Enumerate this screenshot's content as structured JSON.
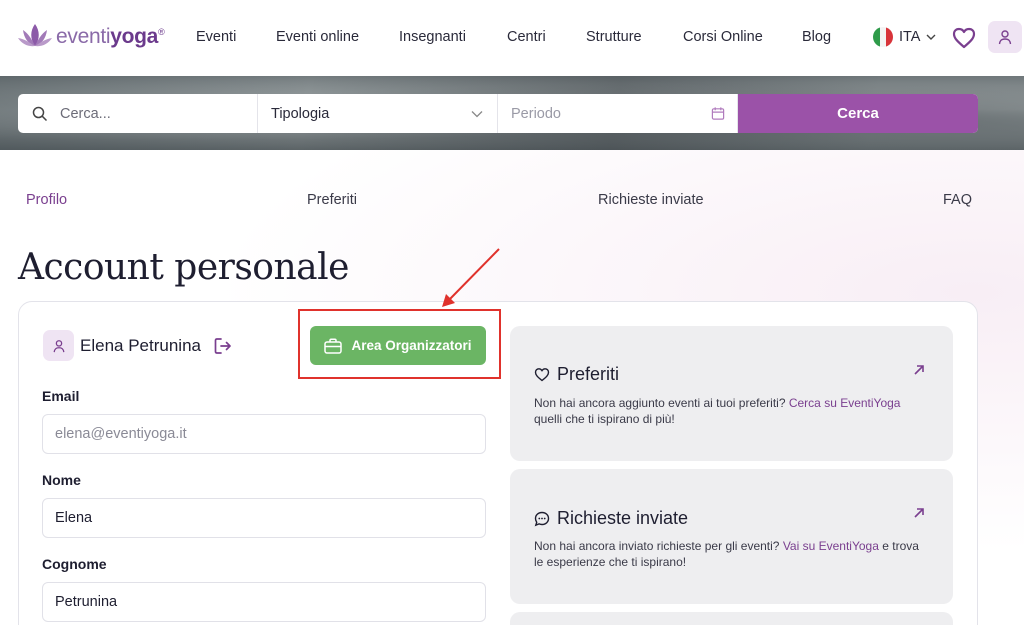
{
  "brand": {
    "logo_part1": "eventi",
    "logo_part2": "yoga",
    "logo_mark": "®",
    "accent": "#9b52a8",
    "green": "#6bb564"
  },
  "nav": {
    "items": [
      {
        "label": "Eventi"
      },
      {
        "label": "Eventi online"
      },
      {
        "label": "Insegnanti"
      },
      {
        "label": "Centri"
      },
      {
        "label": "Strutture"
      },
      {
        "label": "Corsi Online"
      },
      {
        "label": "Blog"
      }
    ],
    "language": "ITA",
    "icons": [
      "italy-flag-icon",
      "chevron-down-icon",
      "heart-icon",
      "user-icon"
    ]
  },
  "search": {
    "query_placeholder": "Cerca...",
    "type_label": "Tipologia",
    "period_placeholder": "Periodo",
    "button_label": "Cerca"
  },
  "tabs": [
    {
      "label": "Profilo",
      "active": true
    },
    {
      "label": "Preferiti",
      "active": false
    },
    {
      "label": "Richieste inviate",
      "active": false
    },
    {
      "label": "FAQ",
      "active": false
    }
  ],
  "page": {
    "title": "Account personale"
  },
  "profile": {
    "name": "Elena Petrunina",
    "organizer_button": "Area Organizzatori",
    "fields": {
      "email_label": "Email",
      "email_value": "elena@eventiyoga.it",
      "name_label": "Nome",
      "name_value": "Elena",
      "surname_label": "Cognome",
      "surname_value": "Petrunina"
    }
  },
  "panels": {
    "favorites": {
      "title": "Preferiti",
      "text": "Non hai ancora aggiunto eventi ai tuoi preferiti? ",
      "link": "Cerca su EventiYoga",
      "text_after": " quelli che ti ispirano di più!"
    },
    "requests": {
      "title": "Richieste inviate",
      "text": "Non hai ancora inviato richieste per gli eventi? ",
      "link": "Vai su EventiYoga",
      "text_after": " e trova le esperienze che ti ispirano!"
    }
  }
}
